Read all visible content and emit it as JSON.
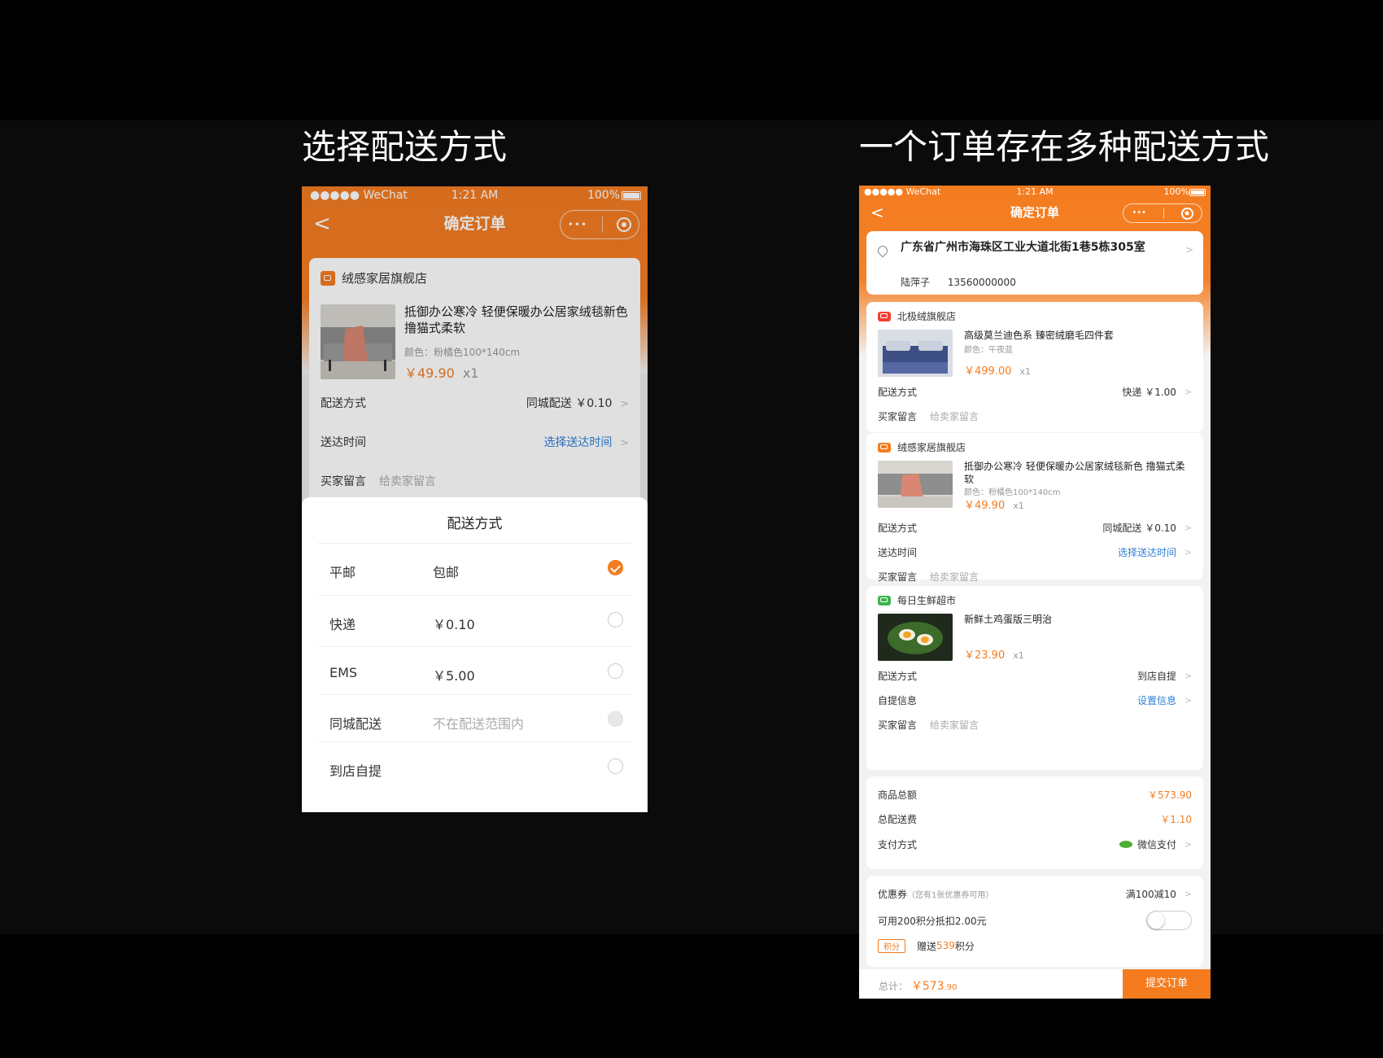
{
  "headings": {
    "left": "选择配送方式",
    "right": "一个订单存在多种配送方式"
  },
  "status_bar": {
    "carrier": "●●●●● WeChat",
    "time": "1:21 AM",
    "battery": "100%"
  },
  "nav": {
    "back": "<",
    "title": "确定订单",
    "menu": "•••",
    "close_icon": "close-target-icon"
  },
  "left": {
    "shop": "绒感家居旗舰店",
    "product": {
      "title": "抵御办公寒冷 轻便保暖办公居家绒毯新色 撸猫式柔软",
      "spec": "颜色：粉橘色100*140cm",
      "price": "￥49.90",
      "qty": "x1"
    },
    "delivery": {
      "label": "配送方式",
      "value": "同城配送 ￥0.10"
    },
    "time": {
      "label": "送达时间",
      "value": "选择送达时间"
    },
    "message": {
      "label": "买家留言",
      "placeholder": "给卖家留言"
    },
    "sheet": {
      "title": "配送方式",
      "options": [
        {
          "name": "平邮",
          "price": "包邮",
          "state": "selected"
        },
        {
          "name": "快递",
          "price": "￥0.10",
          "state": "normal"
        },
        {
          "name": "EMS",
          "price": "￥5.00",
          "state": "normal"
        },
        {
          "name": "同城配送",
          "price": "不在配送范围内",
          "state": "disabled"
        },
        {
          "name": "到店自提",
          "price": "",
          "state": "normal"
        }
      ]
    }
  },
  "right": {
    "address": {
      "line": "广东省广州市海珠区工业大道北街1巷5栋305室",
      "name": "陆萍子",
      "phone": "13560000000"
    },
    "stores": [
      {
        "shop": "北极绒旗舰店",
        "icon_color": "#f2402e",
        "title": "高级莫兰迪色系  臻密绒磨毛四件套",
        "spec": "颜色：午夜蓝",
        "price": "￥499.00",
        "qty": "x1",
        "rows": [
          {
            "label": "配送方式",
            "value": "快递  ￥1.00",
            "link": false
          },
          {
            "label": "买家留言",
            "value": "给卖家留言",
            "placeholder": true
          }
        ]
      },
      {
        "shop": "绒感家居旗舰店",
        "icon_color": "#f47c1f",
        "title": "抵御办公寒冷 轻便保暖办公居家绒毯新色 撸猫式柔软",
        "spec": "颜色：粉橘色100*140cm",
        "price": "￥49.90",
        "qty": "x1",
        "rows": [
          {
            "label": "配送方式",
            "value": "同城配送  ￥0.10",
            "link": false
          },
          {
            "label": "送达时间",
            "value": "选择送达时间",
            "link": true
          },
          {
            "label": "买家留言",
            "value": "给卖家留言",
            "placeholder": true
          }
        ]
      },
      {
        "shop": "每日生鲜超市",
        "icon_color": "#3fb34f",
        "title": "新鲜土鸡蛋版三明治",
        "spec": "",
        "price": "￥23.90",
        "qty": "x1",
        "rows": [
          {
            "label": "配送方式",
            "value": "到店自提",
            "link": false
          },
          {
            "label": "自提信息",
            "value": "设置信息",
            "link": true
          },
          {
            "label": "买家留言",
            "value": "给卖家留言",
            "placeholder": true
          }
        ]
      }
    ],
    "summary": {
      "goods_label": "商品总额",
      "goods_value": "￥573.90",
      "shipping_label": "总配送费",
      "shipping_value": "￥1.10",
      "pay_label": "支付方式",
      "pay_value": "微信支付"
    },
    "coupon": {
      "label": "优惠券",
      "note": "（您有1张优惠券可用）",
      "value": "满100减10"
    },
    "points": {
      "label": "可用200积分抵扣2.00元",
      "toggle": false
    },
    "bonus": {
      "tag": "积分",
      "prefix": "赠送",
      "amount": "539",
      "suffix": "积分"
    },
    "footer": {
      "total_label": "总计：",
      "total_main": "￥573",
      "total_cents": ".90",
      "submit": "提交订单"
    }
  },
  "colors": {
    "accent": "#f47c1f",
    "link": "#2f7fd6",
    "wechat_green": "#4caf33"
  }
}
